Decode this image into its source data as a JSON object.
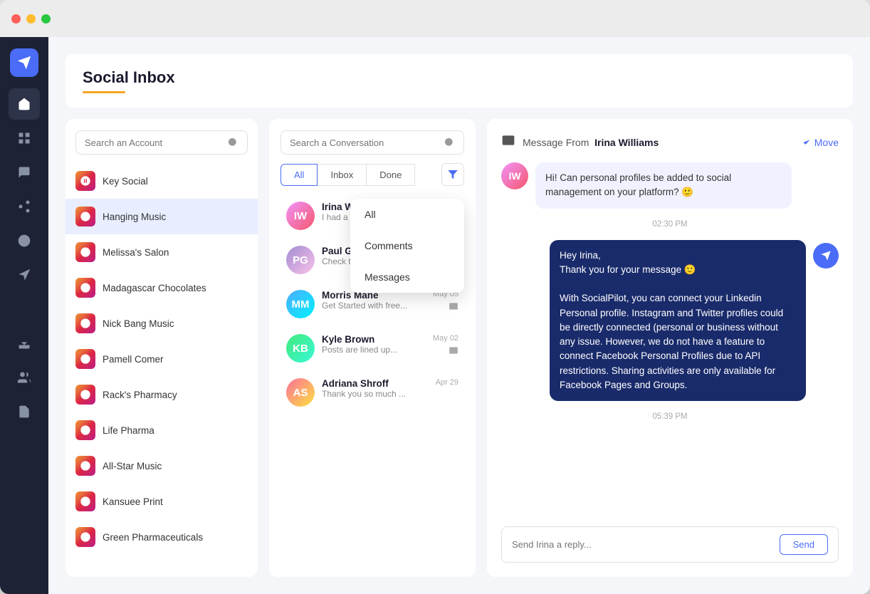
{
  "window": {
    "title": "Social Inbox"
  },
  "header": {
    "title": "Social Inbox"
  },
  "sidebar": {
    "items": [
      {
        "id": "inbox",
        "icon": "paper-plane",
        "active": true
      },
      {
        "id": "dashboard",
        "icon": "grid"
      },
      {
        "id": "comments",
        "icon": "comment"
      },
      {
        "id": "network",
        "icon": "share"
      },
      {
        "id": "target",
        "icon": "target"
      },
      {
        "id": "megaphone",
        "icon": "megaphone"
      },
      {
        "id": "analytics",
        "icon": "bar-chart"
      },
      {
        "id": "download",
        "icon": "download"
      },
      {
        "id": "users",
        "icon": "users"
      },
      {
        "id": "document",
        "icon": "document"
      }
    ]
  },
  "accounts": {
    "search_placeholder": "Search an Account",
    "items": [
      {
        "id": 1,
        "name": "Key Social",
        "active": false
      },
      {
        "id": 2,
        "name": "Hanging Music",
        "active": true
      },
      {
        "id": 3,
        "name": "Melissa's Salon",
        "active": false
      },
      {
        "id": 4,
        "name": "Madagascar Chocolates",
        "active": false
      },
      {
        "id": 5,
        "name": "Nick Bang Music",
        "active": false
      },
      {
        "id": 6,
        "name": "Pamell Comer",
        "active": false
      },
      {
        "id": 7,
        "name": "Rack's Pharmacy",
        "active": false
      },
      {
        "id": 8,
        "name": "Life Pharma",
        "active": false
      },
      {
        "id": 9,
        "name": "All-Star Music",
        "active": false
      },
      {
        "id": 10,
        "name": "Kansuee Print",
        "active": false
      },
      {
        "id": 11,
        "name": "Green Pharmaceuticals",
        "active": false
      }
    ]
  },
  "conversations": {
    "search_placeholder": "Search a Conversation",
    "tabs": [
      "All",
      "Inbox",
      "Done"
    ],
    "active_tab": "All",
    "dropdown_items": [
      "All",
      "Comments",
      "Messages"
    ],
    "items": [
      {
        "id": 1,
        "name": "Irina Will...",
        "preview": "I had a qu...",
        "date": "",
        "avatar_initials": "IW"
      },
      {
        "id": 2,
        "name": "Paul Gar...",
        "preview": "Check thi...",
        "date": "",
        "avatar_initials": "PG"
      },
      {
        "id": 3,
        "name": "Morris Mane",
        "preview": "Get Started with free...",
        "date": "May 05",
        "avatar_initials": "MM"
      },
      {
        "id": 4,
        "name": "Kyle Brown",
        "preview": "Posts are lined up...",
        "date": "May 02",
        "avatar_initials": "KB"
      },
      {
        "id": 5,
        "name": "Adriana Shroff",
        "preview": "Thank you so much ...",
        "date": "Apr 29",
        "avatar_initials": "AS"
      }
    ]
  },
  "message": {
    "from_label": "Message From",
    "from_name": "Irina Williams",
    "move_label": "Move",
    "reply_placeholder": "Send Irina a reply...",
    "send_label": "Send",
    "incoming": {
      "text": "Hi! Can personal profiles be added to social management on your platform? 🙂",
      "time": "02:30 PM",
      "avatar_initials": "IW"
    },
    "outgoing": {
      "text": "Hey Irina,\nThank you for your message 🙂\n\nWith SocialPilot, you can connect your Linkedin Personal profile. Instagram and Twitter profiles could be directly connected (personal or business without any issue. However, we do not have a feature to connect Facebook Personal Profiles due to API restrictions. Sharing activities are only available for Facebook Pages and Groups.",
      "time": "05:39 PM"
    }
  }
}
